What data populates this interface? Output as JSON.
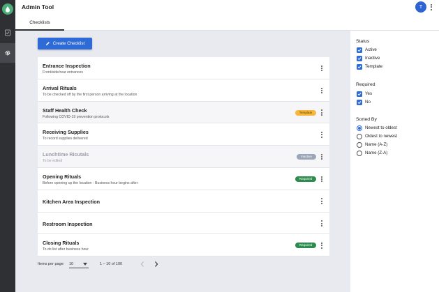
{
  "app": {
    "title": "Admin Tool",
    "user_initial": "T"
  },
  "tabs": [
    {
      "label": "Checklists",
      "active": true
    }
  ],
  "toolbar": {
    "create_label": "Create Checklist"
  },
  "checklists": [
    {
      "title": "Entrance Inspection",
      "subtitle": "Front/side/rear entrances",
      "badge": ""
    },
    {
      "title": "Arrival Rituals",
      "subtitle": "To be checked off by the first person arriving at the location",
      "badge": ""
    },
    {
      "title": "Staff Health Check",
      "subtitle": "Following COVID-19 prevention protocols",
      "badge": "Template"
    },
    {
      "title": "Receiving Supplies",
      "subtitle": "To record supplies delivered",
      "badge": ""
    },
    {
      "title": "Lunchtime Ricutals",
      "subtitle": "To be edited",
      "badge": "Inactive"
    },
    {
      "title": "Opening Rituals",
      "subtitle": "Before opening up the location - Business hour begins after",
      "badge": "Required"
    },
    {
      "title": "Kitchen Area Inspection",
      "subtitle": "",
      "badge": ""
    },
    {
      "title": "Restroom Inspection",
      "subtitle": "",
      "badge": ""
    },
    {
      "title": "Closing Rituals",
      "subtitle": "To do list after business hour",
      "badge": "Required"
    }
  ],
  "pagination": {
    "label": "Items per page:",
    "per_page": "10",
    "range": "1 – 10 of 100"
  },
  "filters": {
    "status": {
      "title": "Status",
      "options": [
        {
          "label": "Active",
          "checked": true
        },
        {
          "label": "Inactive",
          "checked": true
        },
        {
          "label": "Template",
          "checked": true
        }
      ]
    },
    "required": {
      "title": "Required",
      "options": [
        {
          "label": "Yes",
          "checked": true
        },
        {
          "label": "No",
          "checked": true
        }
      ]
    },
    "sorted_by": {
      "title": "Sorted By",
      "selected": "Newest to oldest",
      "options": [
        {
          "label": "Newest to oldest"
        },
        {
          "label": "Oldest to newest"
        },
        {
          "label": "Name (A-Z)"
        },
        {
          "label": "Name (Z-A)"
        }
      ]
    }
  },
  "colors": {
    "primary": "#2f6bd6",
    "rail": "#2f3033",
    "template": "#f6b73c",
    "inactive": "#9ba6b6",
    "required": "#2e8b4e"
  },
  "icons": {
    "logo": "drop-logo-icon",
    "nav_checklist": "checklist-icon",
    "nav_settings": "gear-icon",
    "create": "pencil-icon",
    "more": "more-vertical-icon"
  }
}
